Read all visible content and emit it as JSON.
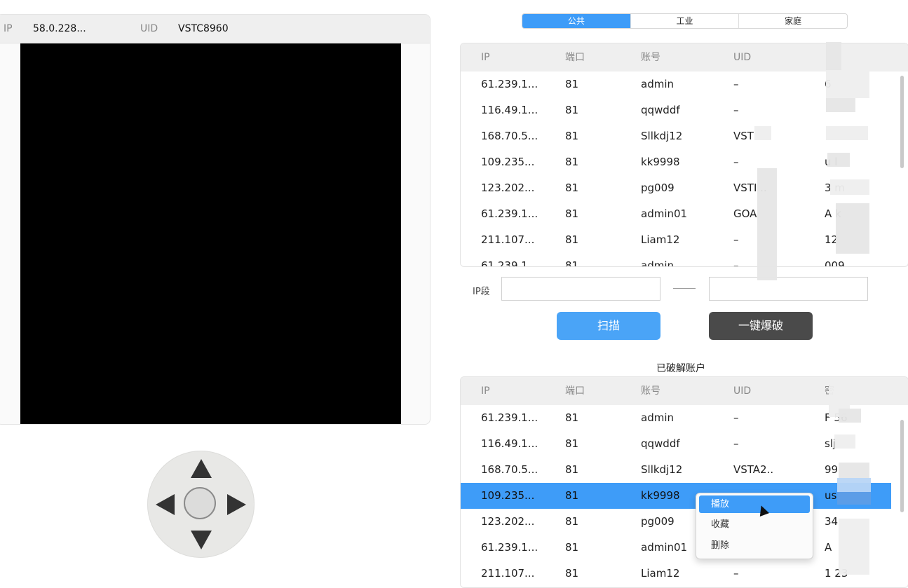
{
  "camera": {
    "ip_label": "IP",
    "ip_value": "58.0.228...",
    "uid_label": "UID",
    "uid_value": "VSTC8960"
  },
  "segments": [
    "公共",
    "工业",
    "家庭"
  ],
  "columns": {
    "ip": "IP",
    "port": "端口",
    "account": "账号",
    "uid": "UID",
    "password": "密"
  },
  "public_table": {
    "rows": [
      {
        "ip": "61.239.1...",
        "port": "81",
        "account": "admin",
        "uid": "–",
        "password": "6"
      },
      {
        "ip": "116.49.1...",
        "port": "81",
        "account": "qqwddf",
        "uid": "–",
        "password": ""
      },
      {
        "ip": "168.70.5...",
        "port": "81",
        "account": "Sllkdj12",
        "uid": "VST",
        "password": ""
      },
      {
        "ip": "109.235...",
        "port": "81",
        "account": "kk9998",
        "uid": "–",
        "password": "u           l"
      },
      {
        "ip": "123.202...",
        "port": "81",
        "account": "pg009",
        "uid": "VSTI     ..",
        "password": "3           m"
      },
      {
        "ip": "61.239.1...",
        "port": "81",
        "account": "admin01",
        "uid": "GOA",
        "password": "A           k"
      },
      {
        "ip": "211.107...",
        "port": "81",
        "account": "Liam12",
        "uid": "–",
        "password": "12"
      },
      {
        "ip": "61.239.1",
        "port": "81",
        "account": "admin",
        "uid": "–",
        "password": "009"
      }
    ]
  },
  "ip_range": {
    "label": "IP段",
    "start": "",
    "end": ""
  },
  "buttons": {
    "scan": "扫描",
    "crack": "一键爆破"
  },
  "cracked_title": "已破解账户",
  "cracked_table": {
    "rows": [
      {
        "ip": "61.239.1...",
        "port": "81",
        "account": "admin",
        "uid": "–",
        "password": "F          56"
      },
      {
        "ip": "116.49.1...",
        "port": "81",
        "account": "qqwddf",
        "uid": "–",
        "password": "slj"
      },
      {
        "ip": "168.70.5...",
        "port": "81",
        "account": "Sllkdj12",
        "uid": "VSTA2..",
        "password": "99"
      },
      {
        "ip": "109.235...",
        "port": "81",
        "account": "kk9998",
        "uid": "",
        "password": "us",
        "selected": true
      },
      {
        "ip": "123.202...",
        "port": "81",
        "account": "pg009",
        "uid": "",
        "password": "34"
      },
      {
        "ip": "61.239.1...",
        "port": "81",
        "account": "admin01",
        "uid": "",
        "password": "A"
      },
      {
        "ip": "211.107...",
        "port": "81",
        "account": "Liam12",
        "uid": "–",
        "password": "1          23"
      }
    ]
  },
  "context_menu": [
    "播放",
    "收藏",
    "删除"
  ],
  "colors": {
    "accent": "#3e9cf8",
    "dark_button": "#4a4a4a",
    "video": "#000000"
  }
}
